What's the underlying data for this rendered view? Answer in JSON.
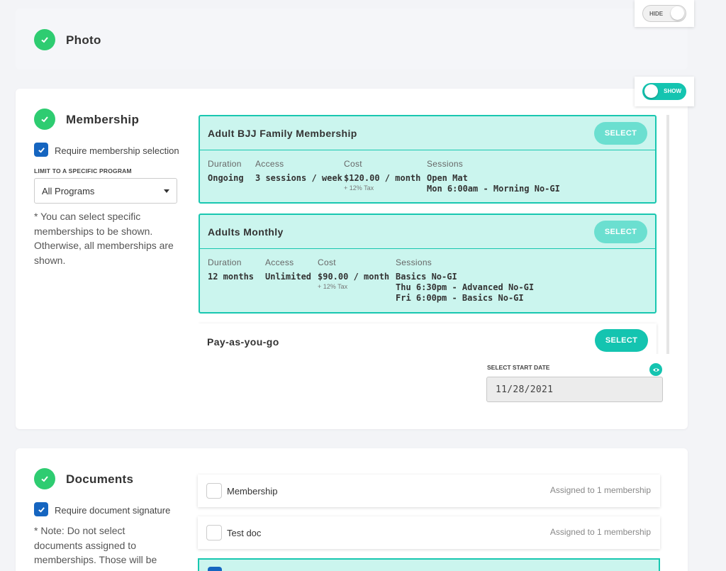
{
  "photo": {
    "title": "Photo",
    "toggle_label": "HIDE",
    "toggle_on": false
  },
  "membership": {
    "title": "Membership",
    "toggle_label": "SHOW",
    "toggle_on": true,
    "require_label": "Require membership selection",
    "require_checked": true,
    "limit_label": "LIMIT TO A SPECIFIC PROGRAM",
    "program_select_value": "All Programs",
    "note": "* You can select specific memberships to be shown. Otherwise, all memberships are shown.",
    "plans": [
      {
        "name": "Adult BJJ Family Membership",
        "select_label": "SELECT",
        "duration_label": "Duration",
        "duration": "Ongoing",
        "access_label": "Access",
        "access": "3 sessions / week",
        "cost_label": "Cost",
        "cost": "$120.00 / month",
        "tax": "+ 12% Tax",
        "sessions_label": "Sessions",
        "sessions": [
          "Open Mat",
          "Mon 6:00am - Morning No-GI"
        ]
      },
      {
        "name": "Adults Monthly",
        "select_label": "SELECT",
        "duration_label": "Duration",
        "duration": "12 months",
        "access_label": "Access",
        "access": "Unlimited",
        "cost_label": "Cost",
        "cost": "$90.00 / month",
        "tax": "+ 12% Tax",
        "sessions_label": "Sessions",
        "sessions": [
          "Basics No-GI",
          "Thu 6:30pm - Advanced No-GI",
          "Fri 6:00pm - Basics No-GI"
        ]
      },
      {
        "name": "Pay-as-you-go",
        "select_label": "SELECT"
      }
    ],
    "start_date_label": "SELECT START DATE",
    "start_date_value": "11/28/2021"
  },
  "documents": {
    "title": "Documents",
    "require_label": "Require document signature",
    "require_checked": true,
    "note": "* Note: Do not select documents assigned to memberships. Those will be shown when a",
    "items": [
      {
        "name": "Membership",
        "assigned": "Assigned to 1 membership",
        "checked": false
      },
      {
        "name": "Test doc",
        "assigned": "Assigned to 1 membership",
        "checked": false
      }
    ]
  },
  "colors": {
    "accent": "#14c4b0",
    "check_green": "#2ecc71",
    "checkbox_blue": "#1565c0",
    "selected_card_bg": "#cbf5ee"
  },
  "icons": [
    "check-icon",
    "checkbox-check-icon",
    "chevron-down-icon",
    "eye-icon"
  ]
}
